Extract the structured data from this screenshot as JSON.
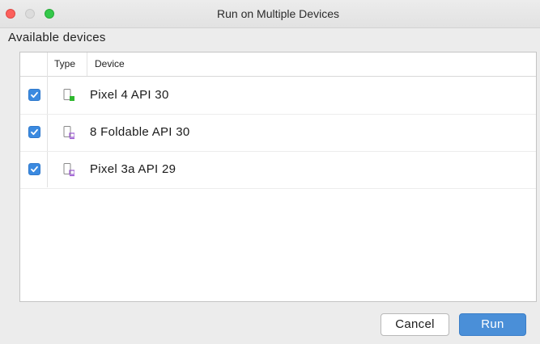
{
  "window": {
    "title": "Run on Multiple Devices"
  },
  "section_label": "Available devices",
  "table": {
    "headers": {
      "type": "Type",
      "device": "Device"
    },
    "rows": [
      {
        "checked": true,
        "type_icon": "phone-online-icon",
        "device": "Pixel 4 API 30"
      },
      {
        "checked": true,
        "type_icon": "phone-offline-icon",
        "device": "8  Foldable API 30"
      },
      {
        "checked": true,
        "type_icon": "phone-offline-icon",
        "device": "Pixel 3a API 29"
      }
    ]
  },
  "buttons": {
    "cancel": "Cancel",
    "run": "Run"
  },
  "colors": {
    "accent": "#4a8fd8",
    "close": "#fc605c",
    "maximize": "#34c84a",
    "device_online": "#2eb82e",
    "device_offline": "#9b59d0"
  }
}
